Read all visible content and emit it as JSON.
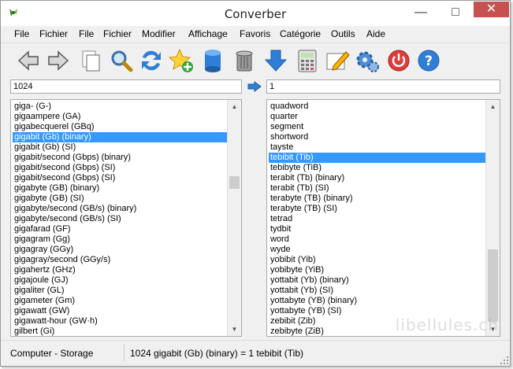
{
  "window": {
    "title": "Converber"
  },
  "titlebar": {
    "minimize": "—",
    "maximize": "□",
    "close": "✕"
  },
  "menu": [
    "File",
    "Fichier",
    "File",
    "Fichier",
    "Modifier",
    "Affichage",
    "Favoris",
    "Catégorie",
    "Outils",
    "Aide"
  ],
  "toolbar": {
    "icons": [
      "arrow-left-icon",
      "arrow-right-icon",
      "copy-icon",
      "search-icon",
      "swap-icon",
      "star-add-icon",
      "database-icon",
      "trash-icon",
      "download-icon",
      "calculator-icon",
      "edit-icon",
      "gear-icon",
      "power-icon",
      "help-icon"
    ]
  },
  "inputs": {
    "left_value": "1024",
    "right_value": "1"
  },
  "left_list": {
    "items": [
      "giga- (G-)",
      "gigaampere (GA)",
      "gigabecquerel (GBq)",
      "gigabit (Gb) (binary)",
      "gigabit (Gb) (SI)",
      "gigabit/second (Gbps) (binary)",
      "gigabit/second (Gbps) (SI)",
      "gigabit/second (Gbps) (SI)",
      "gigabyte (GB) (binary)",
      "gigabyte (GB) (SI)",
      "gigabyte/second (GB/s) (binary)",
      "gigabyte/second (GB/s) (SI)",
      "gigafarad (GF)",
      "gigagram (Gg)",
      "gigagray (GGy)",
      "gigagray/second (GGy/s)",
      "gigahertz (GHz)",
      "gigajoule (GJ)",
      "gigaliter (GL)",
      "gigameter (Gm)",
      "gigawatt (GW)",
      "gigawatt-hour (GW·h)",
      "gilbert (Gi)"
    ],
    "selected_index": 3
  },
  "right_list": {
    "items": [
      "quadword",
      "quarter",
      "segment",
      "shortword",
      "tayste",
      "tebibit (Tib)",
      "tebibyte (TiB)",
      "terabit (Tb) (binary)",
      "terabit (Tb) (SI)",
      "terabyte (TB) (binary)",
      "terabyte (TB) (SI)",
      "tetrad",
      "tydbit",
      "word",
      "wyde",
      "yobibit (Yib)",
      "yobibyte (YiB)",
      "yottabit (Yb) (binary)",
      "yottabit (Yb) (SI)",
      "yottabyte (YB) (binary)",
      "yottabyte (YB) (SI)",
      "zebibit (Zib)",
      "zebibyte (ZiB)"
    ],
    "selected_index": 5
  },
  "status": {
    "category": "Computer - Storage",
    "result": "1024 gigabit (Gb) (binary) = 1 tebibit (Tib)"
  },
  "watermark": "libellules.ch",
  "colors": {
    "selection": "#3399ff",
    "close_button": "#c75050"
  }
}
